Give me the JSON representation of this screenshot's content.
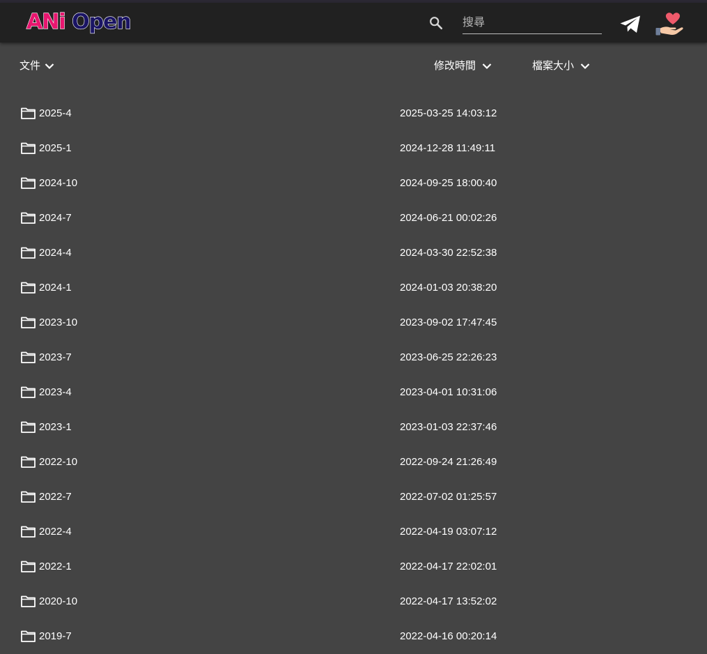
{
  "header": {
    "logo_part1": "ANi",
    "logo_part2": "Open",
    "search_placeholder": "搜尋",
    "search_value": "",
    "icons": [
      "search-icon",
      "telegram-icon",
      "donate-heart-hand-icon"
    ]
  },
  "columns": {
    "name": "文件",
    "modified": "修改時間",
    "size": "檔案大小"
  },
  "folders": [
    {
      "name": "2025-4",
      "modified": "2025-03-25 14:03:12"
    },
    {
      "name": "2025-1",
      "modified": "2024-12-28 11:49:11"
    },
    {
      "name": "2024-10",
      "modified": "2024-09-25 18:00:40"
    },
    {
      "name": "2024-7",
      "modified": "2024-06-21 00:02:26"
    },
    {
      "name": "2024-4",
      "modified": "2024-03-30 22:52:38"
    },
    {
      "name": "2024-1",
      "modified": "2024-01-03 20:38:20"
    },
    {
      "name": "2023-10",
      "modified": "2023-09-02 17:47:45"
    },
    {
      "name": "2023-7",
      "modified": "2023-06-25 22:26:23"
    },
    {
      "name": "2023-4",
      "modified": "2023-04-01 10:31:06"
    },
    {
      "name": "2023-1",
      "modified": "2023-01-03 22:37:46"
    },
    {
      "name": "2022-10",
      "modified": "2022-09-24 21:26:49"
    },
    {
      "name": "2022-7",
      "modified": "2022-07-02 01:25:57"
    },
    {
      "name": "2022-4",
      "modified": "2022-04-19 03:07:12"
    },
    {
      "name": "2022-1",
      "modified": "2022-04-17 22:02:01"
    },
    {
      "name": "2020-10",
      "modified": "2022-04-17 13:52:02"
    },
    {
      "name": "2019-7",
      "modified": "2022-04-16 00:20:14"
    }
  ],
  "colors": {
    "background": "#444444",
    "header": "#212121",
    "logo_pink": "#e8166f",
    "logo_navy": "#1a1464",
    "heart": "#ef5a6b"
  }
}
